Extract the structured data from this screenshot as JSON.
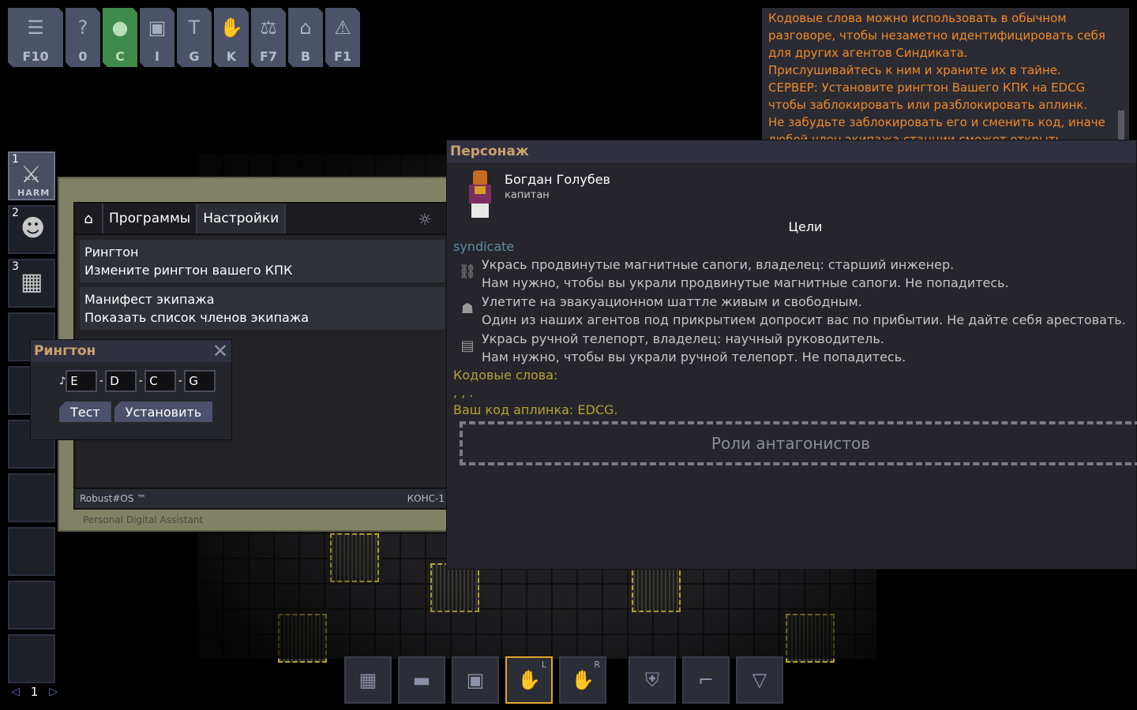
{
  "menu": [
    {
      "name": "escape-menu-button",
      "icon": "menu-icon",
      "glyph": "☰",
      "key": "F10",
      "active": false,
      "wide": true
    },
    {
      "name": "guidebook-button",
      "icon": "question-icon",
      "glyph": "?",
      "key": "0",
      "active": false
    },
    {
      "name": "character-button",
      "icon": "person-icon",
      "glyph": "●",
      "key": "C",
      "active": true
    },
    {
      "name": "inventory-button",
      "icon": "backpack-icon",
      "glyph": "▣",
      "key": "I",
      "active": false
    },
    {
      "name": "crafting-button",
      "icon": "hammer-icon",
      "glyph": "T",
      "key": "G",
      "active": false
    },
    {
      "name": "actions-button",
      "icon": "hand-icon",
      "glyph": "✋",
      "key": "K",
      "active": false
    },
    {
      "name": "admin-button",
      "icon": "gavel-icon",
      "glyph": "⚖",
      "key": "F7",
      "active": false
    },
    {
      "name": "sandbox-button",
      "icon": "sandbox-icon",
      "glyph": "⌂",
      "key": "B",
      "active": false
    },
    {
      "name": "ahelp-button",
      "icon": "warning-icon",
      "glyph": "⚠",
      "key": "F1",
      "active": false
    }
  ],
  "chat": {
    "lines": [
      "Кодовые слова можно использовать в обычном",
      "разговоре, чтобы незаметно идентифицировать себя",
      "для других агентов Синдиката.",
      "Прислушивайтесь к ним и храните их в тайне.",
      "СЕРВЕР: Установите рингтон Вашего КПК на EDCG",
      "чтобы заблокировать или разблокировать аплинк.",
      "Не забудьте заблокировать его и сменить код, иначе",
      "любой член экипажа станции сможет открыть аплинк!"
    ]
  },
  "hotbar": {
    "slots": [
      {
        "num": "1",
        "label": "HARM",
        "icon": "combat-mode-icon"
      },
      {
        "num": "2",
        "label": "",
        "icon": "head-icon"
      },
      {
        "num": "3",
        "label": "",
        "icon": "pda-icon"
      },
      {
        "num": "",
        "label": "",
        "icon": ""
      },
      {
        "num": "",
        "label": "",
        "icon": ""
      },
      {
        "num": "",
        "label": "",
        "icon": ""
      },
      {
        "num": "",
        "label": "",
        "icon": ""
      },
      {
        "num": "",
        "label": "",
        "icon": ""
      },
      {
        "num": "",
        "label": "",
        "icon": ""
      },
      {
        "num": "",
        "label": "",
        "icon": ""
      }
    ],
    "page": "1"
  },
  "pda": {
    "tabs": {
      "programs": "Программы",
      "settings": "Настройки"
    },
    "items": [
      {
        "title": "Рингтон",
        "subtitle": "Измените рингтон вашего КПК"
      },
      {
        "title": "Манифест экипажа",
        "subtitle": "Показать список членов экипажа"
      }
    ],
    "footer_left": "Robust#OS ™",
    "footer_right": "КОНС-1",
    "caption": "Personal Digital Assistant"
  },
  "ringtone": {
    "title": "Рингтон",
    "note_glyph": "♪",
    "notes": [
      "E",
      "D",
      "C",
      "G"
    ],
    "test_label": "Тест",
    "set_label": "Установить"
  },
  "character": {
    "title": "Персонаж",
    "name": "Богдан Голубев",
    "job": "капитан",
    "goals_title": "Цели",
    "antag": "syndicate",
    "objectives": [
      {
        "icon": "magboots-icon",
        "glyph": "⛓",
        "a": "Укрась продвинутые магнитные сапоги, владелец: старший инженер.",
        "b": "Нам нужно, чтобы вы украли продвинутые магнитные сапоги. Не попадитесь."
      },
      {
        "icon": "shuttle-icon",
        "glyph": "☗",
        "a": "Улетите на эвакуационном шаттле живым и свободным.",
        "b": "Один из наших агентов под прикрытием допросит вас по прибытии. Не дайте себя арестовать."
      },
      {
        "icon": "teleporter-icon",
        "glyph": "▤",
        "a": "Укрась ручной телепорт, владелец: научный руководитель.",
        "b": "Нам нужно, чтобы вы украли ручной телепорт. Не попадитесь."
      }
    ],
    "codewords_label": "Кодовые слова:",
    "codewords": ", , .",
    "uplink_code": "Ваш код аплинка: EDCG.",
    "antag_roles": "Роли антагонистов"
  },
  "inventory": [
    {
      "name": "id-slot",
      "icon": "pda-icon",
      "glyph": "▦",
      "hand": ""
    },
    {
      "name": "belt-slot",
      "icon": "belt-icon",
      "glyph": "▬",
      "hand": ""
    },
    {
      "name": "back-slot",
      "icon": "backpack-icon",
      "glyph": "▣",
      "hand": ""
    },
    {
      "name": "left-hand-slot",
      "icon": "hand-icon",
      "glyph": "✋",
      "hand": "L",
      "selected": true
    },
    {
      "name": "right-hand-slot",
      "icon": "hand-icon",
      "glyph": "✋",
      "hand": "R"
    },
    {
      "name": "outer-clothing-slot",
      "icon": "armor-icon",
      "glyph": "⛨",
      "hand": "",
      "gap": true
    },
    {
      "name": "suit-storage-slot",
      "icon": "gun-icon",
      "glyph": "⌐",
      "hand": ""
    },
    {
      "name": "inner-clothing-slot",
      "icon": "shirt-icon",
      "glyph": "▽",
      "hand": ""
    }
  ]
}
